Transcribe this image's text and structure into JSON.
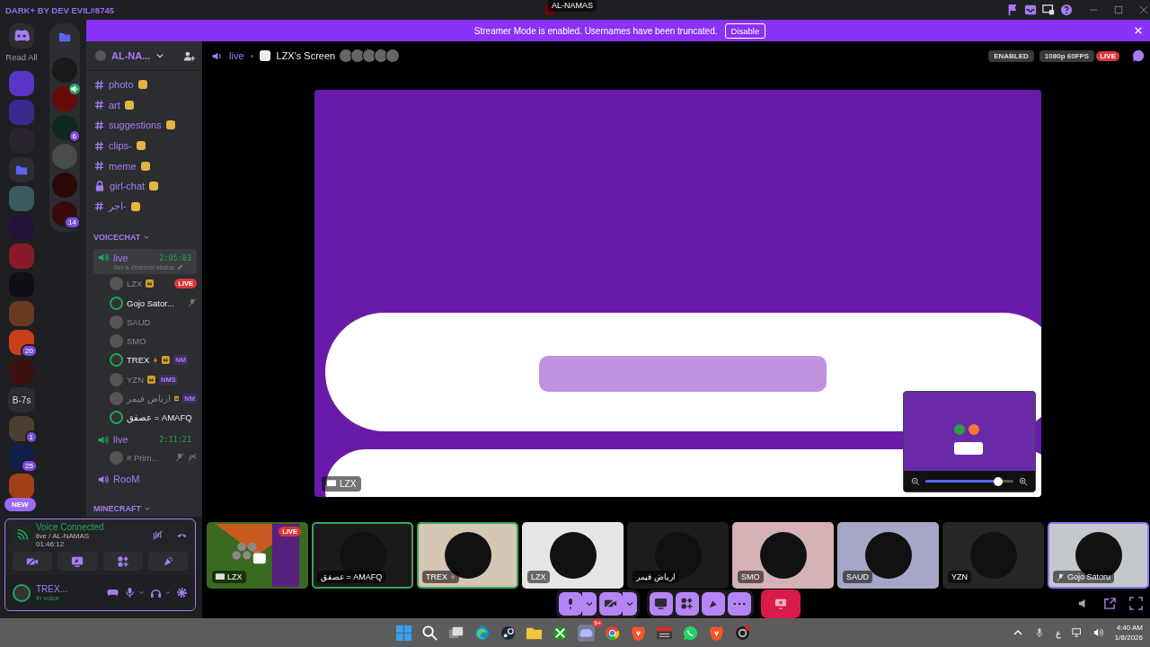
{
  "titlebar": {
    "theme": "DARK+ BY DEV EVIL#8745",
    "server": "AL-NAMAS"
  },
  "banner": {
    "message": "Streamer Mode is enabled. Usernames have been truncated.",
    "button": "Disable"
  },
  "server_rail": {
    "home_label": "Read All",
    "new_label": "NEW",
    "servers": [
      {
        "kind": "server",
        "color": "#5a35c8"
      },
      {
        "kind": "server",
        "color": "#3a2a90"
      },
      {
        "kind": "server",
        "color": "#2a2430"
      },
      {
        "kind": "folder",
        "color": "#2b2d31"
      },
      {
        "kind": "server",
        "color": "#3d5a60"
      },
      {
        "kind": "server",
        "color": "#24123a"
      },
      {
        "kind": "server",
        "color": "#8a1a2a"
      },
      {
        "kind": "server",
        "color": "#101014"
      },
      {
        "kind": "server",
        "color": "#6a3a20"
      },
      {
        "kind": "server",
        "color": "#c8401a",
        "badge": "20"
      },
      {
        "kind": "server",
        "color": "#3a1010"
      },
      {
        "kind": "text",
        "color": "#2b2d31",
        "label": "B-7s"
      },
      {
        "kind": "server",
        "color": "#4a4030",
        "badge": "1"
      },
      {
        "kind": "server",
        "color": "#10204a",
        "badge": "25"
      },
      {
        "kind": "server",
        "color": "#a0401a"
      }
    ]
  },
  "folder_rail": [
    {
      "color": "#1a1a1a",
      "voice": false
    },
    {
      "color": "#6a0a0a",
      "voice": true
    },
    {
      "color": "#0e2a1e",
      "voice": false,
      "badge": "6"
    },
    {
      "color": "#4a4a4a",
      "voice": false
    },
    {
      "color": "#2a0808",
      "voice": false
    },
    {
      "color": "#3a0a0a",
      "voice": false,
      "badge": "14"
    }
  ],
  "server_header": {
    "name": "AL-NA..."
  },
  "text_channels": [
    {
      "kind": "text",
      "name": "photo"
    },
    {
      "kind": "text",
      "name": "art"
    },
    {
      "kind": "text",
      "name": "suggestions"
    },
    {
      "kind": "text",
      "name": "clips-"
    },
    {
      "kind": "text",
      "name": "meme"
    },
    {
      "kind": "locked",
      "name": "girl-chat"
    },
    {
      "kind": "text",
      "name": "اجر-"
    }
  ],
  "voice_category": "VOICECHAT",
  "voice_channels": [
    {
      "name": "live",
      "timer": "2:05:03",
      "selected": true,
      "status_hint": "Set a channel status",
      "members": [
        {
          "name": "LZX",
          "speaking": false,
          "boost": true,
          "bolt": false,
          "live": "LIVE",
          "muted": false,
          "deafened": false
        },
        {
          "name": "Gojo Sator...",
          "speaking": true,
          "boost": false,
          "bolt": false,
          "muted": true,
          "deafened": false
        },
        {
          "name": "SAUD",
          "speaking": false,
          "boost": false,
          "bolt": false,
          "muted": false,
          "deafened": false
        },
        {
          "name": "SMO",
          "speaking": false,
          "boost": false,
          "bolt": false,
          "muted": false,
          "deafened": false
        },
        {
          "name": "TREX",
          "speaking": true,
          "boost": true,
          "bolt": true,
          "tag": "NM",
          "muted": false,
          "deafened": false
        },
        {
          "name": "YZN",
          "speaking": false,
          "boost": true,
          "bolt": false,
          "tag": "NMS",
          "muted": false,
          "deafened": false
        },
        {
          "name": "ارياض فيمر",
          "speaking": false,
          "boost": true,
          "bolt": false,
          "tag": "NM",
          "muted": false,
          "deafened": false
        },
        {
          "name": "عصفق = AMAFQ",
          "speaking": true,
          "boost": false,
          "bolt": false,
          "muted": false,
          "deafened": false
        }
      ]
    },
    {
      "name": "live",
      "timer": "2:11:21",
      "selected": false,
      "members": [
        {
          "name": "# Prim...",
          "speaking": false,
          "boost": false,
          "bolt": false,
          "muted": true,
          "deafened": true
        }
      ]
    },
    {
      "name": "RooM",
      "selected": false
    }
  ],
  "second_category": "MINECRAFT",
  "voice_panel": {
    "title": "Voice Connected",
    "channel": "live / AL-NAMAS",
    "elapsed": "01:46:12",
    "user": "TREX...",
    "status": "In voice"
  },
  "stage_header": {
    "channel": "live",
    "stream_title": "LZX's Screen",
    "pills": [
      {
        "kind": "plain",
        "text": "ENABLED"
      },
      {
        "kind": "quality",
        "text": "1080p 60FPS"
      },
      {
        "kind": "live",
        "text": "LIVE"
      }
    ]
  },
  "stream": {
    "label": "LZX",
    "zoom": {
      "level": 0.83
    }
  },
  "tiles": [
    {
      "kind": "stream",
      "name": "LZX",
      "live": "LIVE",
      "speaking": false,
      "selected": false,
      "bolt": false,
      "muted": false,
      "color": "#3a6a20"
    },
    {
      "kind": "user",
      "name": "عصفق = AMAFQ",
      "speaking": true,
      "selected": false,
      "bolt": false,
      "muted": false,
      "color": "#1a1a1a"
    },
    {
      "kind": "user",
      "name": "TREX",
      "speaking": true,
      "selected": false,
      "bolt": true,
      "muted": false,
      "color": "#d6c6b4"
    },
    {
      "kind": "user",
      "name": "LZX",
      "speaking": false,
      "selected": false,
      "bolt": false,
      "muted": false,
      "color": "#e6e6e6"
    },
    {
      "kind": "user",
      "name": "ارياض فيمر",
      "speaking": false,
      "selected": false,
      "bolt": false,
      "muted": false,
      "color": "#1c1c1c"
    },
    {
      "kind": "user",
      "name": "SMO",
      "speaking": false,
      "selected": false,
      "bolt": false,
      "muted": false,
      "color": "#d4b2b6"
    },
    {
      "kind": "user",
      "name": "SAUD",
      "speaking": false,
      "selected": false,
      "bolt": false,
      "muted": false,
      "color": "#a6a6c6"
    },
    {
      "kind": "user",
      "name": "YZN",
      "speaking": false,
      "selected": false,
      "bolt": false,
      "muted": false,
      "color": "#262626"
    },
    {
      "kind": "user",
      "name": "Gojo Satoru",
      "speaking": false,
      "selected": true,
      "bolt": false,
      "muted": true,
      "color": "#c4c8cc"
    }
  ],
  "taskbar": {
    "app_badge": "9+",
    "keyboard": "ع",
    "time": "4:40 AM",
    "date": "1/8/2026"
  }
}
